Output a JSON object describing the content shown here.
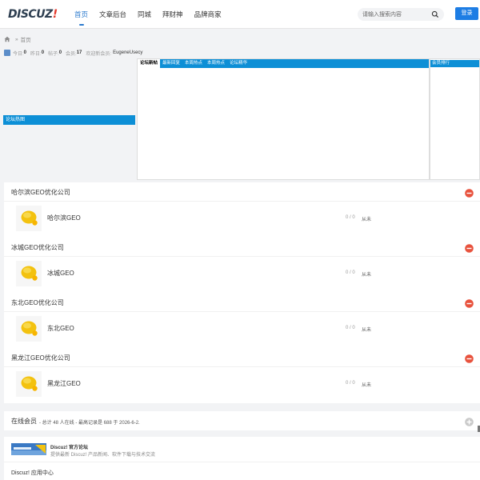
{
  "header": {
    "logo_main": "DISCUZ",
    "logo_bang": "!",
    "nav": [
      {
        "label": "首页",
        "active": true
      },
      {
        "label": "文章后台",
        "active": false
      },
      {
        "label": "同城",
        "active": false
      },
      {
        "label": "拜财神",
        "active": false
      },
      {
        "label": "品牌商家",
        "active": false
      }
    ],
    "search_placeholder": "请输入搜索内容",
    "login_label": "登录"
  },
  "breadcrumb": {
    "sep": "»",
    "current": "首页"
  },
  "stats": {
    "today_label": "今日:",
    "today": "0",
    "yesterday_label": "昨日:",
    "yesterday": "0",
    "posts_label": "帖子:",
    "posts": "0",
    "members_label": "会员:",
    "members": "17",
    "welcome_label": "欢迎新会员:",
    "newest_member": "EugeneUsecy"
  },
  "panels": {
    "left_title": "论坛热图",
    "tabs": [
      "论坛新帖",
      "最新回复",
      "本周热点",
      "本周热点",
      "论坛精华"
    ],
    "right_title": "会员排行"
  },
  "categories": [
    {
      "title": "哈尔滨GEO优化公司",
      "forum": "哈尔滨GEO",
      "counts": "0 / 0",
      "last": "从未"
    },
    {
      "title": "冰城GEO优化公司",
      "forum": "冰城GEO",
      "counts": "0 / 0",
      "last": "从未"
    },
    {
      "title": "东北GEO优化公司",
      "forum": "东北GEO",
      "counts": "0 / 0",
      "last": "从未"
    },
    {
      "title": "黑龙江GEO优化公司",
      "forum": "黑龙江GEO",
      "counts": "0 / 0",
      "last": "从未"
    }
  ],
  "online": {
    "title": "在线会员",
    "info": "- 总计 48 人在线 - 最高记录是 688 于 2026-6-2."
  },
  "links": {
    "name": "Discuz! 官方论坛",
    "desc": "提供最新 Discuz! 产品新闻、软件下载与技术交流",
    "app_center": "Discuz! 应用中心"
  },
  "colors": {
    "accent": "#0d8fd6",
    "brand_red": "#e43a2c",
    "login_blue": "#1d7de4"
  }
}
